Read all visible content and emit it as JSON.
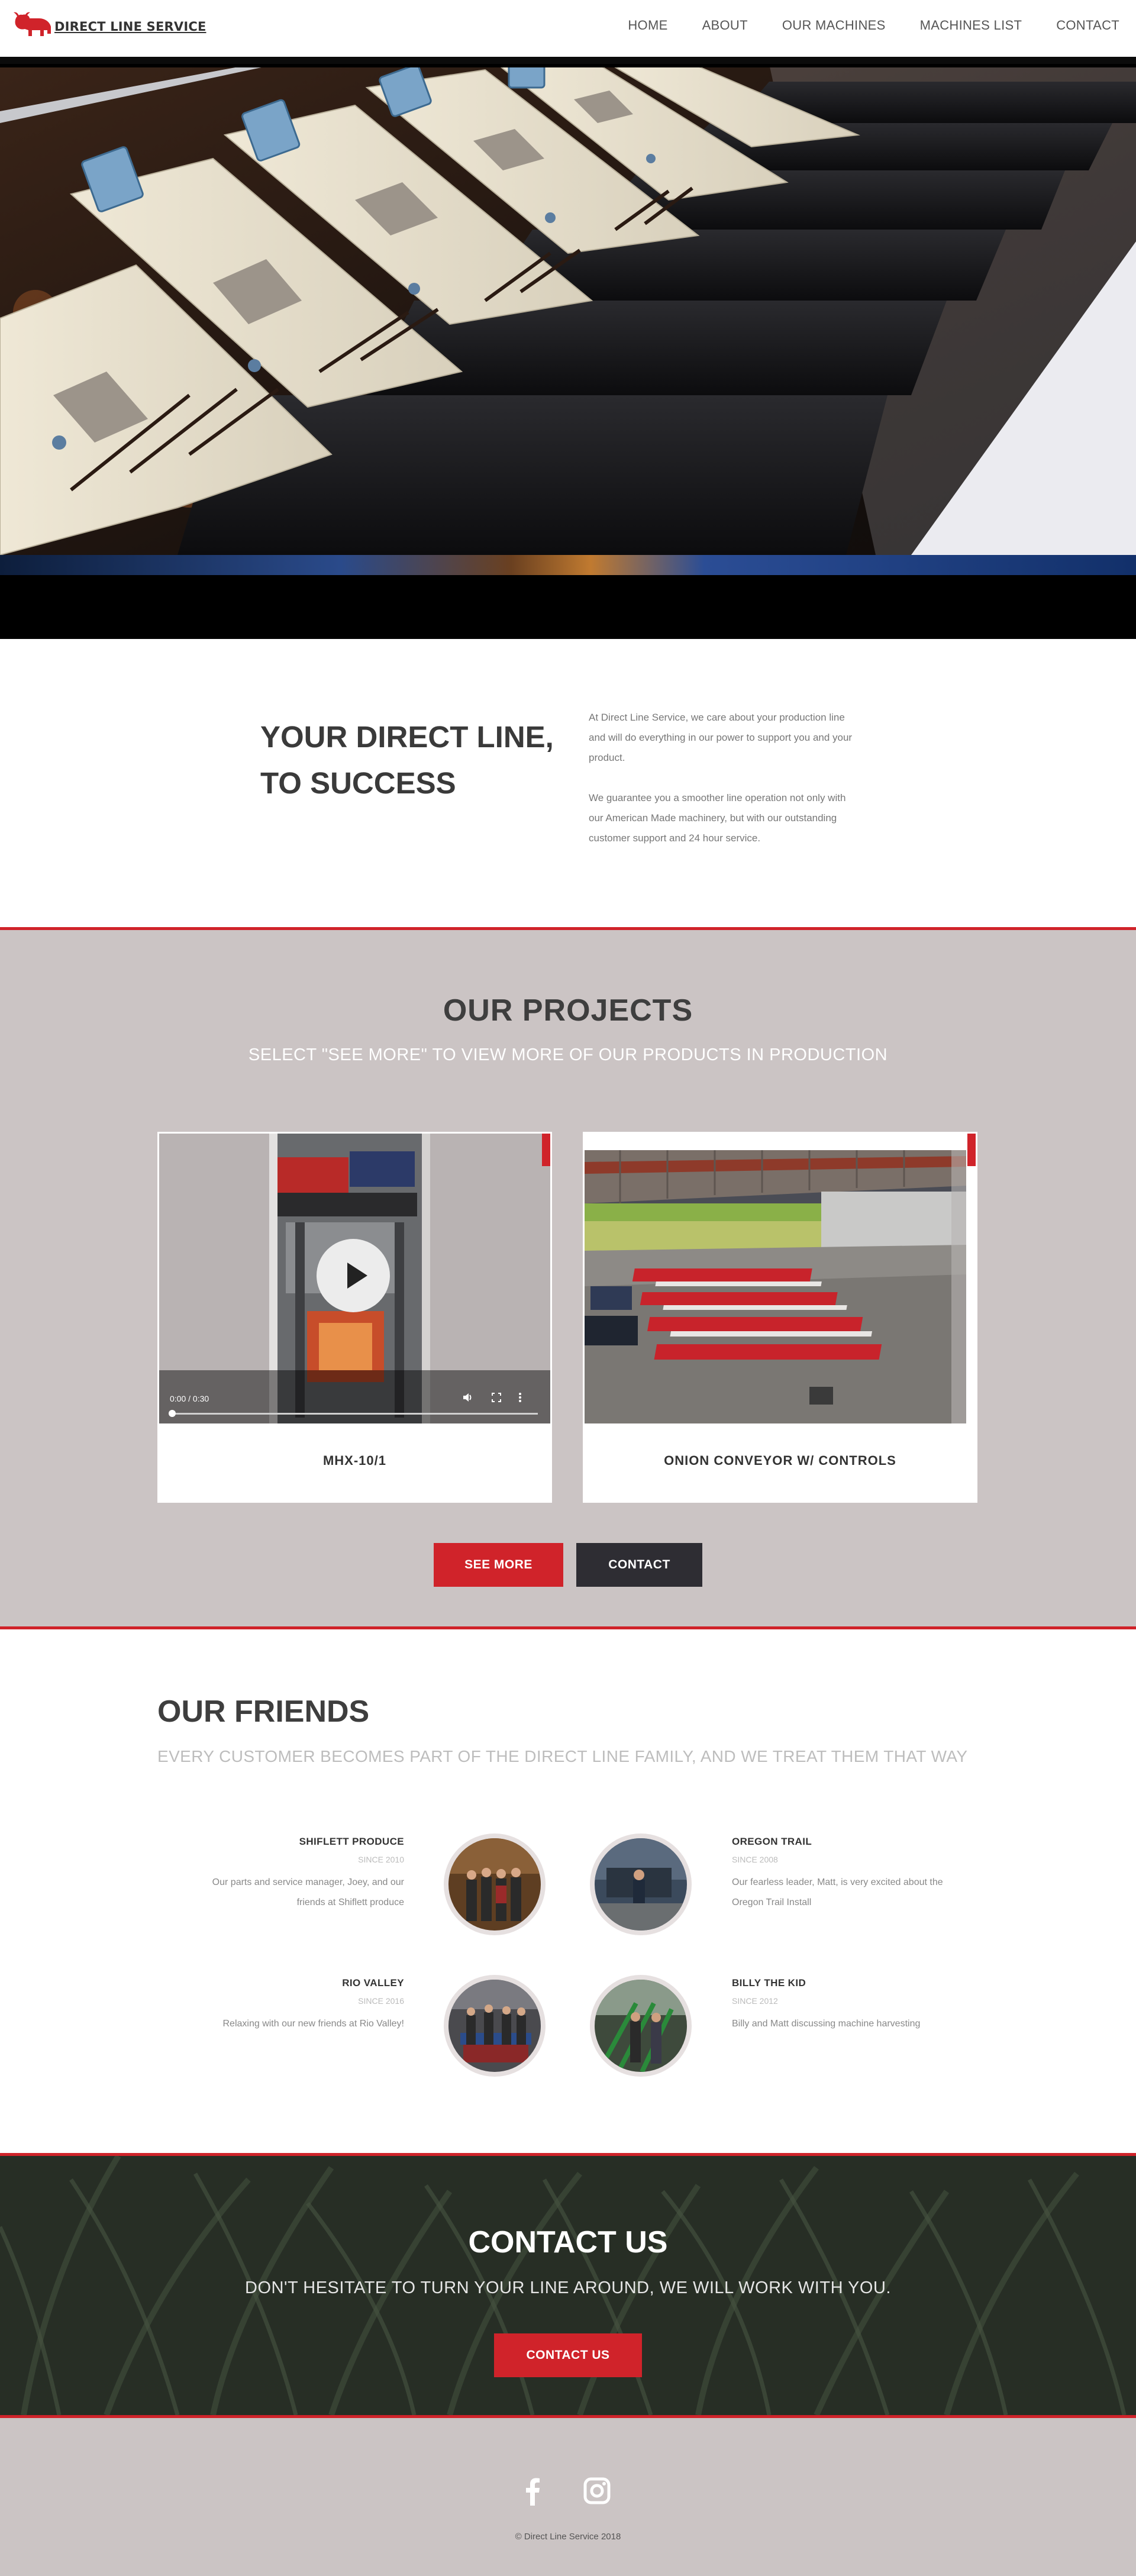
{
  "nav": {
    "logo_text": "DIRECT LINE SERVICE",
    "items": [
      {
        "label": "HOME"
      },
      {
        "label": "ABOUT"
      },
      {
        "label": "OUR MACHINES"
      },
      {
        "label": "MACHINES LIST"
      },
      {
        "label": "CONTACT"
      }
    ]
  },
  "intro": {
    "title_line1": "YOUR DIRECT LINE,",
    "title_line2": "TO SUCCESS",
    "para1_lines": [
      "At Direct Line Service, we care about your production line",
      "and will do everything in our power to support you and your",
      "product."
    ],
    "para2_lines": [
      "We guarantee you a smoother line operation not only with",
      "our American Made machinery, but with our outstanding",
      "customer support and 24 hour service."
    ]
  },
  "projects": {
    "title": "OUR PROJECTS",
    "subtitle": "SELECT \"SEE MORE\" TO VIEW MORE OF OUR PRODUCTS IN PRODUCTION",
    "cards": [
      {
        "label": "MHX-10/1",
        "video_time": "0:00 / 0:30",
        "video_progress": 0.0
      },
      {
        "label": "ONION CONVEYOR W/ CONTROLS"
      }
    ],
    "see_more_label": "SEE MORE",
    "contact_label": "CONTACT"
  },
  "friends": {
    "title": "OUR FRIENDS",
    "subtitle": "EVERY CUSTOMER BECOMES PART OF THE DIRECT LINE FAMILY, AND WE TREAT THEM THAT WAY",
    "items": [
      {
        "name": "SHIFLETT PRODUCE",
        "since": "SINCE 2010",
        "desc_lines": [
          "Our parts and service manager, Joey, and our",
          "friends at Shiflett produce"
        ]
      },
      {
        "name": "OREGON TRAIL",
        "since": "SINCE 2008",
        "desc_lines": [
          "Our fearless leader, Matt, is very excited about the",
          "Oregon Trail Install"
        ]
      },
      {
        "name": "RIO VALLEY",
        "since": "SINCE 2016",
        "desc_lines": [
          "Relaxing with our new friends at Rio Valley!"
        ]
      },
      {
        "name": "BILLY THE KID",
        "since": "SINCE 2012",
        "desc_lines": [
          "Billy and Matt discussing machine harvesting"
        ]
      }
    ]
  },
  "contact": {
    "title": "CONTACT US",
    "subtitle": "DON'T HESITATE TO TURN YOUR LINE AROUND, WE WILL WORK WITH YOU.",
    "button_label": "CONTACT US"
  },
  "footer": {
    "social": [
      "facebook-icon",
      "instagram-icon"
    ],
    "copyright": "© Direct Line Service 2018"
  },
  "colors": {
    "accent": "#d0232a",
    "dark_button": "#2e2d33",
    "section_gray": "#cbc4c4"
  }
}
